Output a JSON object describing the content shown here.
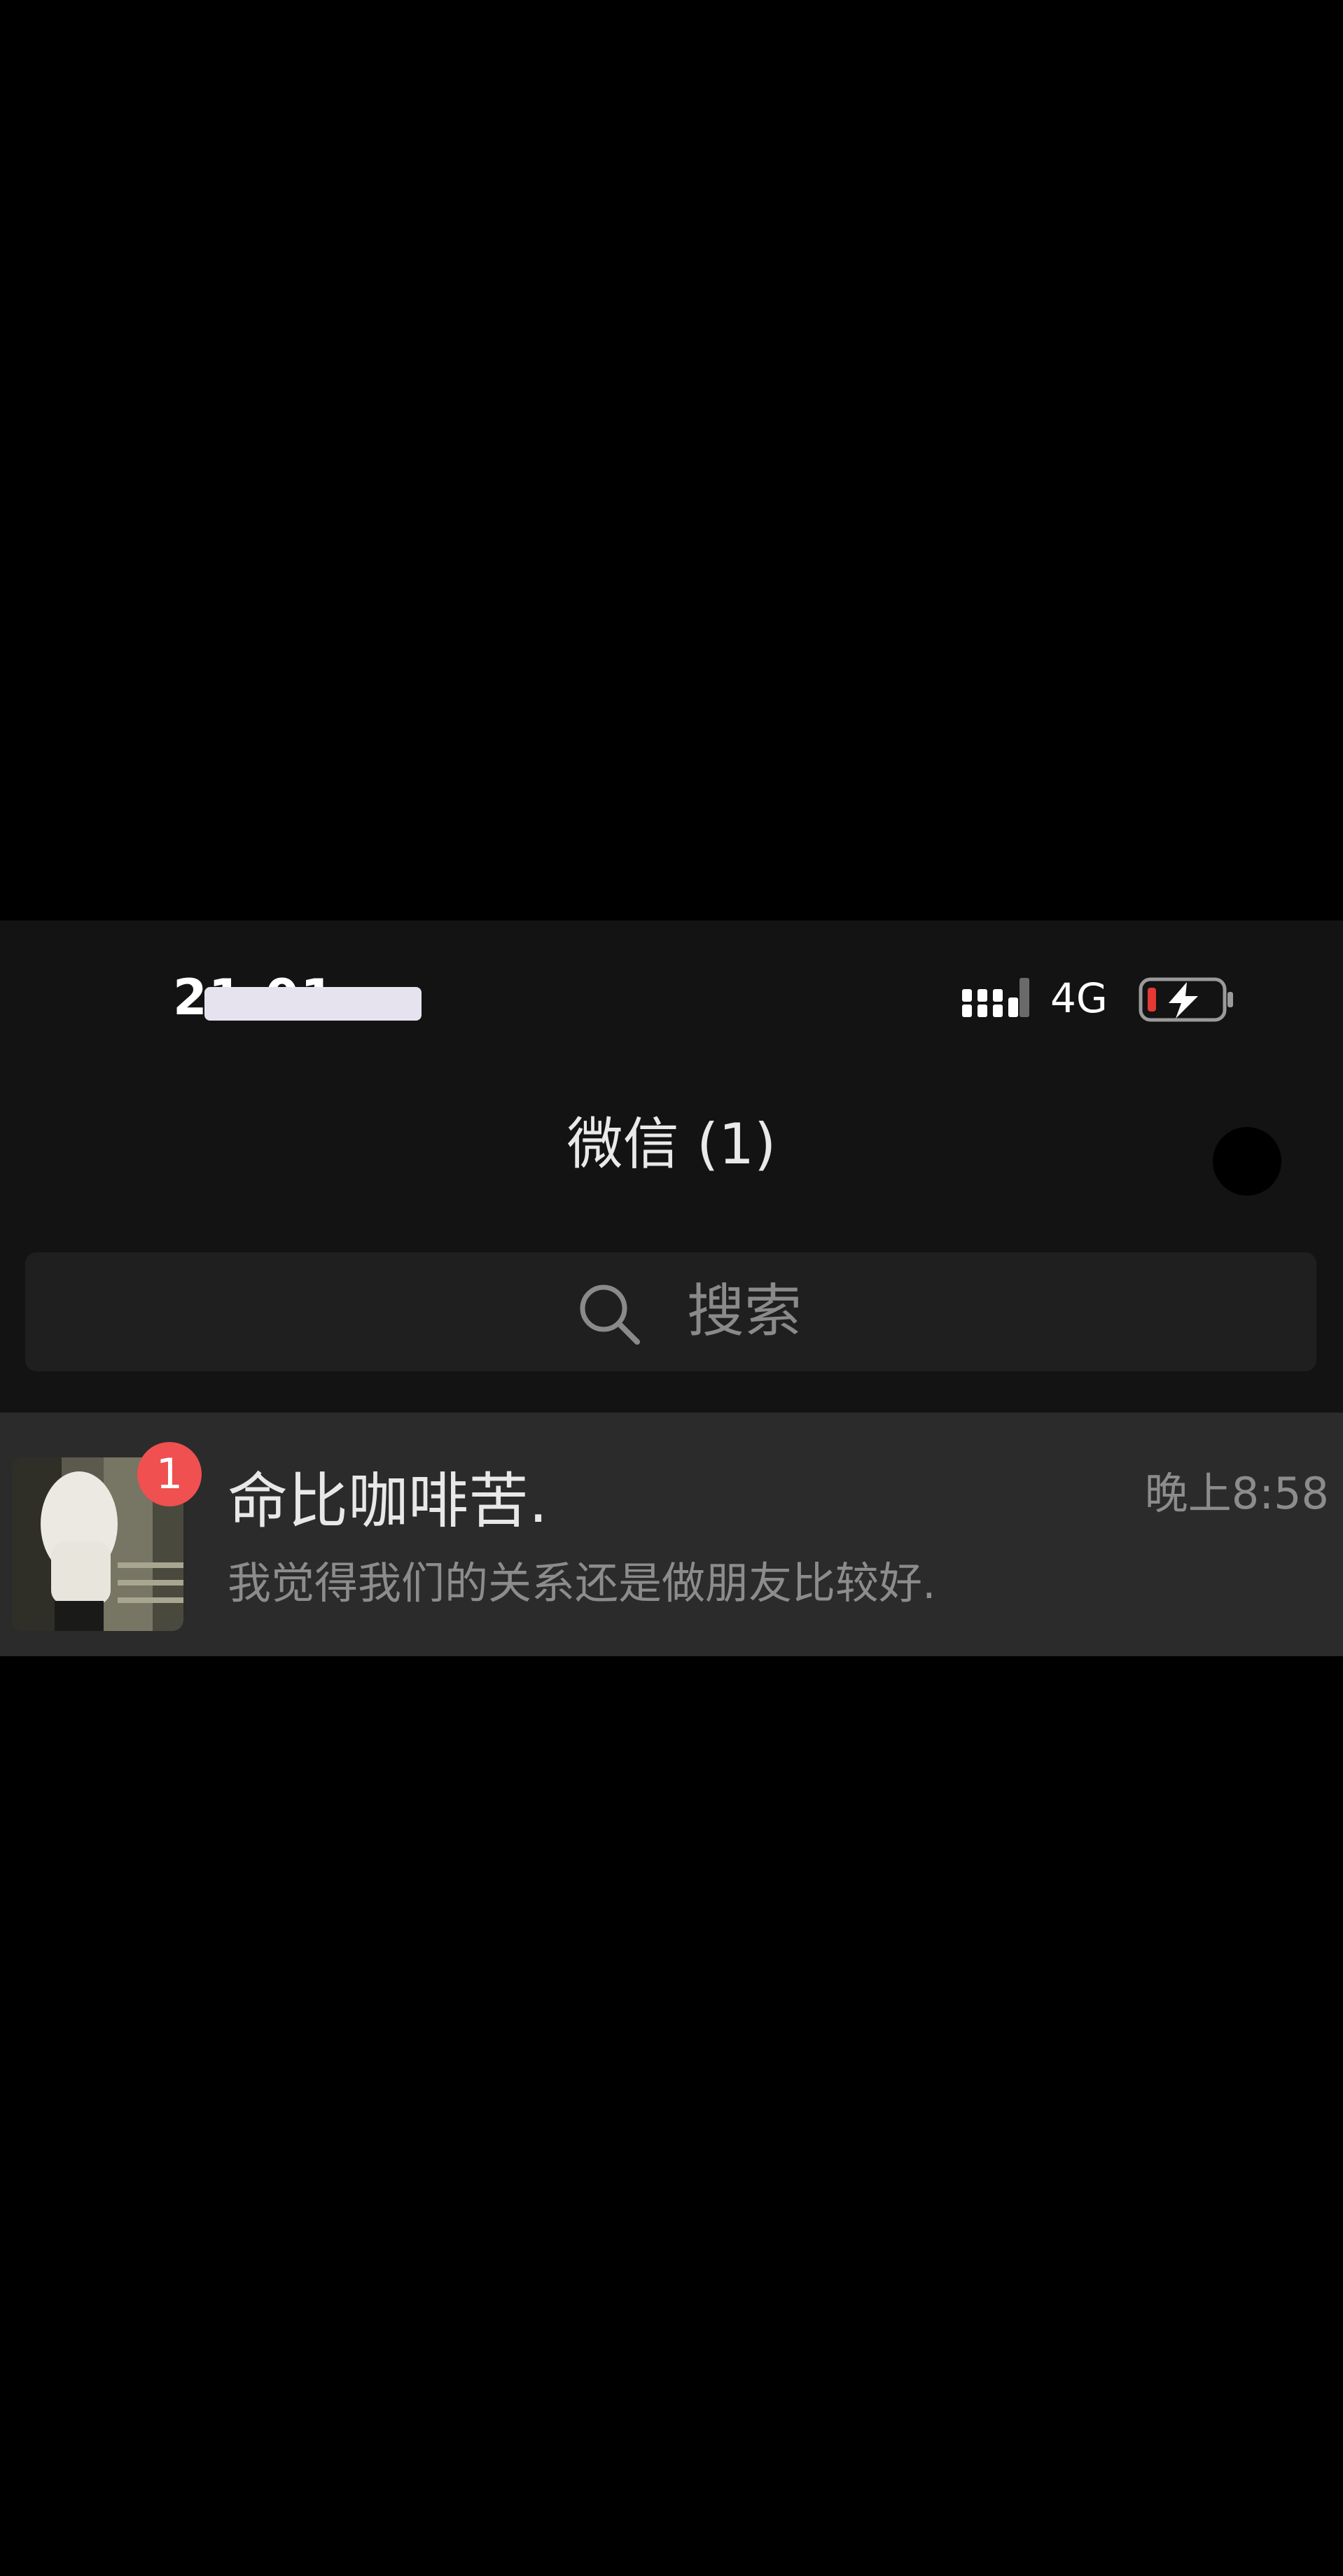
{
  "status_bar": {
    "time": "21:01",
    "network": "4G",
    "signal_icon": "signal-bars-icon",
    "battery_icon": "battery-charging-icon",
    "battery_low_color": "#e53935"
  },
  "header": {
    "title": "微信 (1)",
    "more_icon": "more-icon"
  },
  "search": {
    "placeholder": "搜索",
    "icon": "search-icon"
  },
  "chats": [
    {
      "name": "命比咖啡苦.",
      "time": "晚上8:58",
      "preview": "我觉得我们的关系还是做朋友比较好.",
      "unread": "1",
      "avatar_icon": "avatar-image"
    }
  ],
  "colors": {
    "background": "#000000",
    "panel": "#131313",
    "row": "#2b2b2b",
    "badge": "#f05050"
  }
}
